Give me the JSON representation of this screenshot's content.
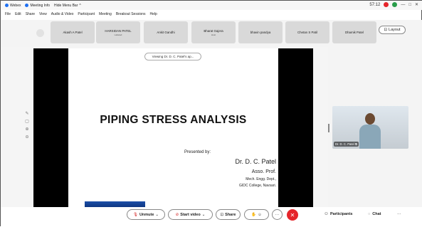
{
  "titlebar": {
    "app": "Webex",
    "meeting_info": "Meeting Info",
    "hide_menu": "Hide Menu Bar",
    "time": "57:12"
  },
  "menu": [
    "File",
    "Edit",
    "Share",
    "View",
    "Audio & Video",
    "Participant",
    "Meeting",
    "Breakout Sessions",
    "Help"
  ],
  "participants": [
    {
      "name": "Akash A Patel",
      "sub": ""
    },
    {
      "name": "HARSIDAN PATEL",
      "sub": "Labeled"
    },
    {
      "name": "Ankit Gandhi",
      "sub": ""
    },
    {
      "name": "Bharat Gajera",
      "sub": "Host"
    },
    {
      "name": "bhavin pandya",
      "sub": ""
    },
    {
      "name": "Chetan S Patil",
      "sub": ""
    },
    {
      "name": "Dhamik Patel",
      "sub": ""
    }
  ],
  "layout_label": "Layout",
  "viewing_label": "Viewing Dr. D. C. Patel's ap...",
  "slide": {
    "title": "PIPING STRESS ANALYSIS",
    "presented_by": "Presented by:",
    "presenter": "Dr. D. C. Patel",
    "designation": "Asso. Prof.",
    "department": "Mech. Engg. Dept.,",
    "college": "GIDC College, Navsari."
  },
  "self_caption": "Dr. D. C. Patel",
  "toolbar": {
    "unmute": "Unmute",
    "start_video": "Start video",
    "share": "Share",
    "participants": "Participants",
    "chat": "Chat",
    "more": "···"
  },
  "colors": {
    "end_call": "#e5252a",
    "slide_bars": "#000000",
    "webex_blue": "#1e6ff1"
  }
}
